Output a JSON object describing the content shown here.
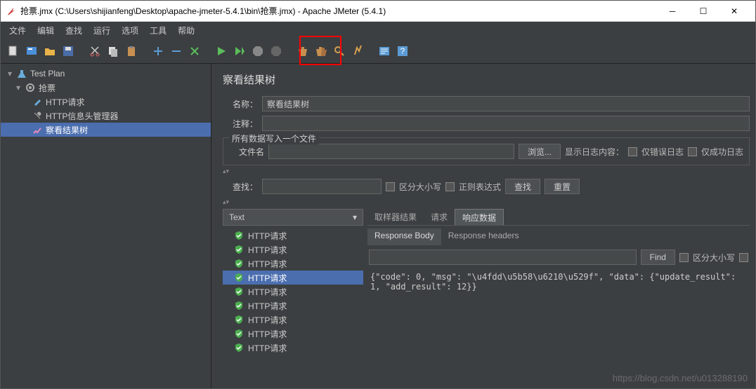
{
  "window": {
    "title": "抢票.jmx (C:\\Users\\shijianfeng\\Desktop\\apache-jmeter-5.4.1\\bin\\抢票.jmx) - Apache JMeter (5.4.1)"
  },
  "menu": [
    "文件",
    "编辑",
    "查找",
    "运行",
    "选项",
    "工具",
    "帮助"
  ],
  "tree": {
    "root": "Test Plan",
    "threadGroup": "抢票",
    "children": [
      "HTTP请求",
      "HTTP信息头管理器",
      "察看结果树"
    ]
  },
  "panel": {
    "title": "察看结果树",
    "nameLabel": "名称：",
    "nameValue": "察看结果树",
    "commentLabel": "注释：",
    "commentValue": "",
    "fileFieldset": "所有数据写入一个文件",
    "filenameLabel": "文件名",
    "filenameValue": "",
    "browseBtn": "浏览...",
    "showLogLabel": "显示日志内容：",
    "errorOnlyLabel": "仅错误日志",
    "successOnlyLabel": "仅成功日志",
    "searchLabel": "查找：",
    "searchValue": "",
    "caseLabel": "区分大小写",
    "regexLabel": "正则表达式",
    "searchBtn": "查找",
    "resetBtn": "重置"
  },
  "results": {
    "renderer": "Text",
    "samples": [
      "HTTP请求",
      "HTTP请求",
      "HTTP请求",
      "HTTP请求",
      "HTTP请求",
      "HTTP请求",
      "HTTP请求",
      "HTTP请求",
      "HTTP请求"
    ],
    "selectedIndex": 3,
    "tabs": [
      "取样器结果",
      "请求",
      "响应数据"
    ],
    "activeTab": 2,
    "subtabs": [
      "Response Body",
      "Response headers"
    ],
    "activeSubtab": 0,
    "findBtn": "Find",
    "findCaseLabel": "区分大小写",
    "responseBody": "{\"code\": 0, \"msg\": \"\\u4fdd\\u5b58\\u6210\\u529f\", \"data\": {\"update_result\": 1, \"add_result\": 12}}"
  },
  "watermark": "https://blog.csdn.net/u013288190"
}
